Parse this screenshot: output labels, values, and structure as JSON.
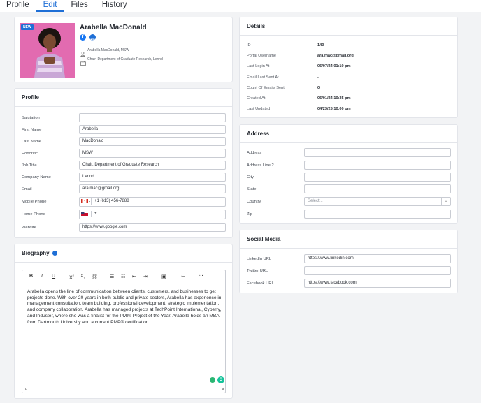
{
  "tabs": [
    "Profile",
    "Edit",
    "Files",
    "History"
  ],
  "header": {
    "badge": "NEW",
    "name": "Arabella MacDonald",
    "display_name": "Arabella MacDonald, MSW",
    "title_org": "Chair, Department of Graduate Research, Lennd"
  },
  "details": {
    "title": "Details",
    "rows": [
      {
        "label": "ID",
        "value": "140"
      },
      {
        "label": "Portal Username",
        "value": "ara.mac@gmail.org"
      },
      {
        "label": "Last Login At",
        "value": "05/07/24 01:10 pm"
      },
      {
        "label": "Email Last Sent At",
        "value": "-"
      },
      {
        "label": "Count Of Emails Sent",
        "value": "0"
      },
      {
        "label": "Created At",
        "value": "05/01/24 10:35 pm"
      },
      {
        "label": "Last Updated",
        "value": "04/23/25 10:00 pm"
      }
    ]
  },
  "profile": {
    "title": "Profile",
    "fields": [
      {
        "label": "Salutation",
        "value": ""
      },
      {
        "label": "First Name",
        "value": "Arabella"
      },
      {
        "label": "Last Name",
        "value": "MacDonald"
      },
      {
        "label": "Honorific",
        "value": "MSW"
      },
      {
        "label": "Job Title",
        "value": "Chair, Department of Graduate Research"
      },
      {
        "label": "Company Name",
        "value": "Lennd"
      },
      {
        "label": "Email",
        "value": "ara.mac@gmail.org"
      },
      {
        "label": "Mobile Phone",
        "value": "+1 (613) 456-7888"
      },
      {
        "label": "Home Phone",
        "value": "+"
      },
      {
        "label": "Website",
        "value": "https://www.google.com"
      }
    ]
  },
  "address": {
    "title": "Address",
    "fields": [
      {
        "label": "Address",
        "value": ""
      },
      {
        "label": "Address Line 2",
        "value": ""
      },
      {
        "label": "City",
        "value": ""
      },
      {
        "label": "State",
        "value": ""
      },
      {
        "label": "Country",
        "value": "Select..."
      },
      {
        "label": "Zip",
        "value": ""
      }
    ]
  },
  "social": {
    "title": "Social Media",
    "fields": [
      {
        "label": "LinkedIn URL",
        "value": "https://www.linkedin.com"
      },
      {
        "label": "Twitter URL",
        "value": ""
      },
      {
        "label": "Facebook URL",
        "value": "https://www.facebook.com"
      }
    ]
  },
  "biography": {
    "title": "Biography",
    "text": "Arabella opens the line of communication between clients, customers, and businesses to get projects done. With over 20 years in both public and private sectors, Arabella has experience in management consultation, team building, professional development, strategic implementation, and company collaboration. Arabella has managed projects at TechPoint International, Cyberry, and Induster, where she was a finalist for the PMI® Project of the Year. Arabella holds an MBA from Dartmouth University and a current PMP® certification.",
    "status": "p"
  },
  "colors": {
    "accent": "#1f6fd6",
    "badge": "#1f6fd6",
    "photo_bg": "#e05aa8"
  }
}
